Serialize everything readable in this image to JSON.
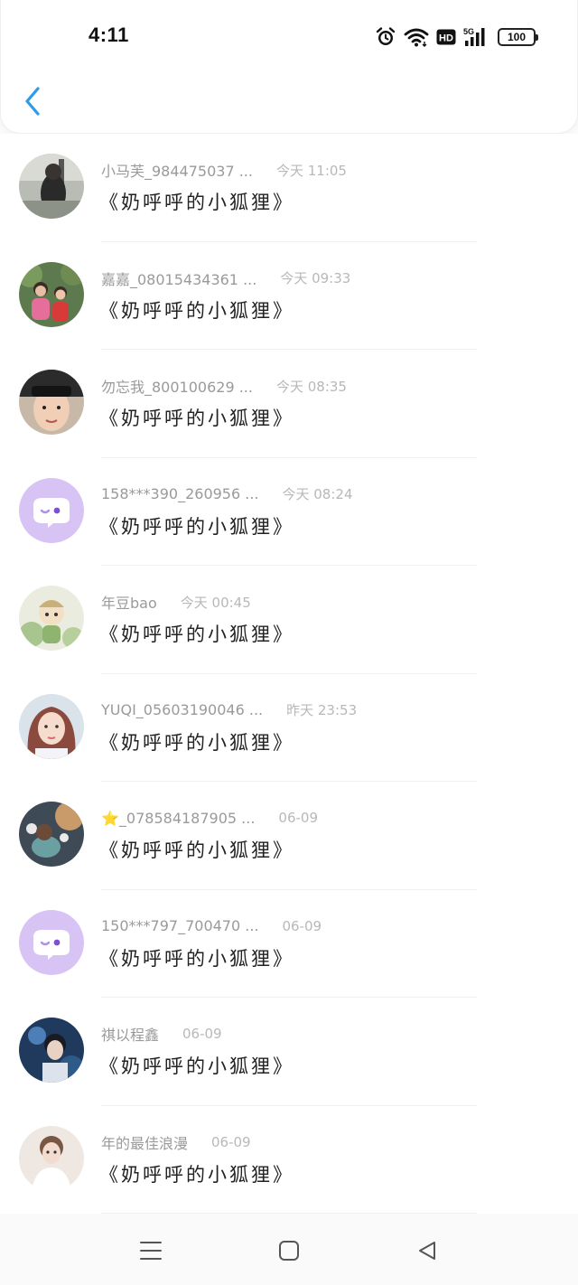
{
  "status_bar": {
    "time": "4:11",
    "battery": "100",
    "icons": [
      "alarm-icon",
      "wifi-icon",
      "hd-icon",
      "signal-5g-icon",
      "battery-icon"
    ]
  },
  "header": {
    "back_icon": "chevron-left-icon",
    "accent_color": "#2f9be6"
  },
  "items": [
    {
      "name": "小马芙_984475037 ...",
      "time": "今天 11:05",
      "title": "《奶呼呼的小狐狸》",
      "avatar": "photo"
    },
    {
      "name": "嘉嘉_08015434361 ...",
      "time": "今天 09:33",
      "title": "《奶呼呼的小狐狸》",
      "avatar": "photo"
    },
    {
      "name": "勿忘我_800100629 ...",
      "time": "今天 08:35",
      "title": "《奶呼呼的小狐狸》",
      "avatar": "photo"
    },
    {
      "name": "158***390_260956 ...",
      "time": "今天 08:24",
      "title": "《奶呼呼的小狐狸》",
      "avatar": "default-chat"
    },
    {
      "name": "年豆bao",
      "time": "今天 00:45",
      "title": "《奶呼呼的小狐狸》",
      "avatar": "photo"
    },
    {
      "name": "YUQI_05603190046 ...",
      "time": "昨天 23:53",
      "title": "《奶呼呼的小狐狸》",
      "avatar": "photo"
    },
    {
      "name": "⭐_078584187905 ...",
      "time": "06-09",
      "title": "《奶呼呼的小狐狸》",
      "avatar": "photo"
    },
    {
      "name": "150***797_700470 ...",
      "time": "06-09",
      "title": "《奶呼呼的小狐狸》",
      "avatar": "default-chat"
    },
    {
      "name": "祺以程鑫",
      "time": "06-09",
      "title": "《奶呼呼的小狐狸》",
      "avatar": "photo"
    },
    {
      "name": "年的最佳浪漫",
      "time": "06-09",
      "title": "《奶呼呼的小狐狸》",
      "avatar": "photo"
    }
  ],
  "nav_bar": {
    "buttons": [
      "menu-icon",
      "home-square-icon",
      "back-triangle-icon"
    ]
  }
}
